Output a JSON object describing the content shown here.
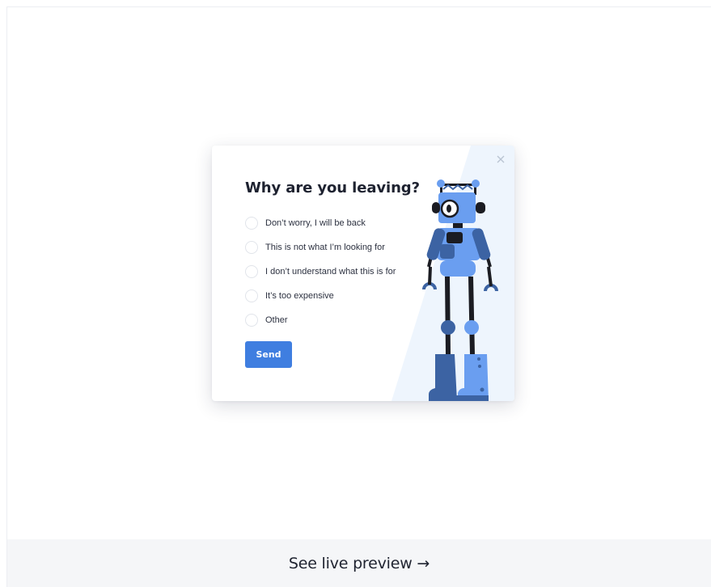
{
  "popup": {
    "title": "Why are you leaving?",
    "options": [
      {
        "label": "Don’t worry, I will be back"
      },
      {
        "label": "This is not what I’m looking for"
      },
      {
        "label": "I don’t understand what this is for"
      },
      {
        "label": "It’s too expensive"
      },
      {
        "label": "Other"
      }
    ],
    "send_label": "Send",
    "close_icon": "close-icon",
    "illustration": "robot-illustration"
  },
  "footer": {
    "link_label": "See live preview →"
  },
  "colors": {
    "accent": "#3f7ee0",
    "robot_blue": "#6a9ef0",
    "robot_dark_blue": "#3c63a3",
    "robot_black": "#1b1c22",
    "panel_tint": "#eef5fd"
  }
}
